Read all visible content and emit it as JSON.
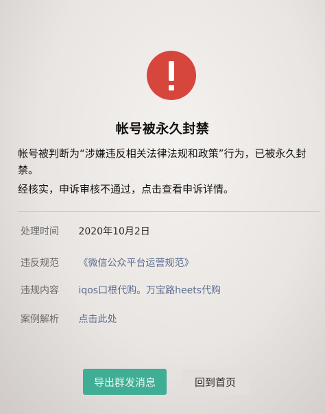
{
  "icon": {
    "name": "exclamation-icon",
    "color": "#d6463d"
  },
  "title": "帐号被永久封禁",
  "description": {
    "line1": "帐号被判断为“涉嫌违反相关法律法规和政策”行为，已被永久封禁。",
    "line2": "经核实，申诉审核不通过，点击查看申诉详情。"
  },
  "details": {
    "time_label": "处理时间",
    "time_value": "2020年10月2日",
    "rule_label": "违反规范",
    "rule_value": "《微信公众平台运营规范》",
    "content_label": "违规内容",
    "content_value": "iqos口根代购。万宝路heets代购",
    "case_label": "案例解析",
    "case_value": "点击此处"
  },
  "buttons": {
    "export_label": "导出群发消息",
    "home_label": "回到首页"
  },
  "colors": {
    "primary": "#3fae94",
    "link": "#5b6d91"
  }
}
